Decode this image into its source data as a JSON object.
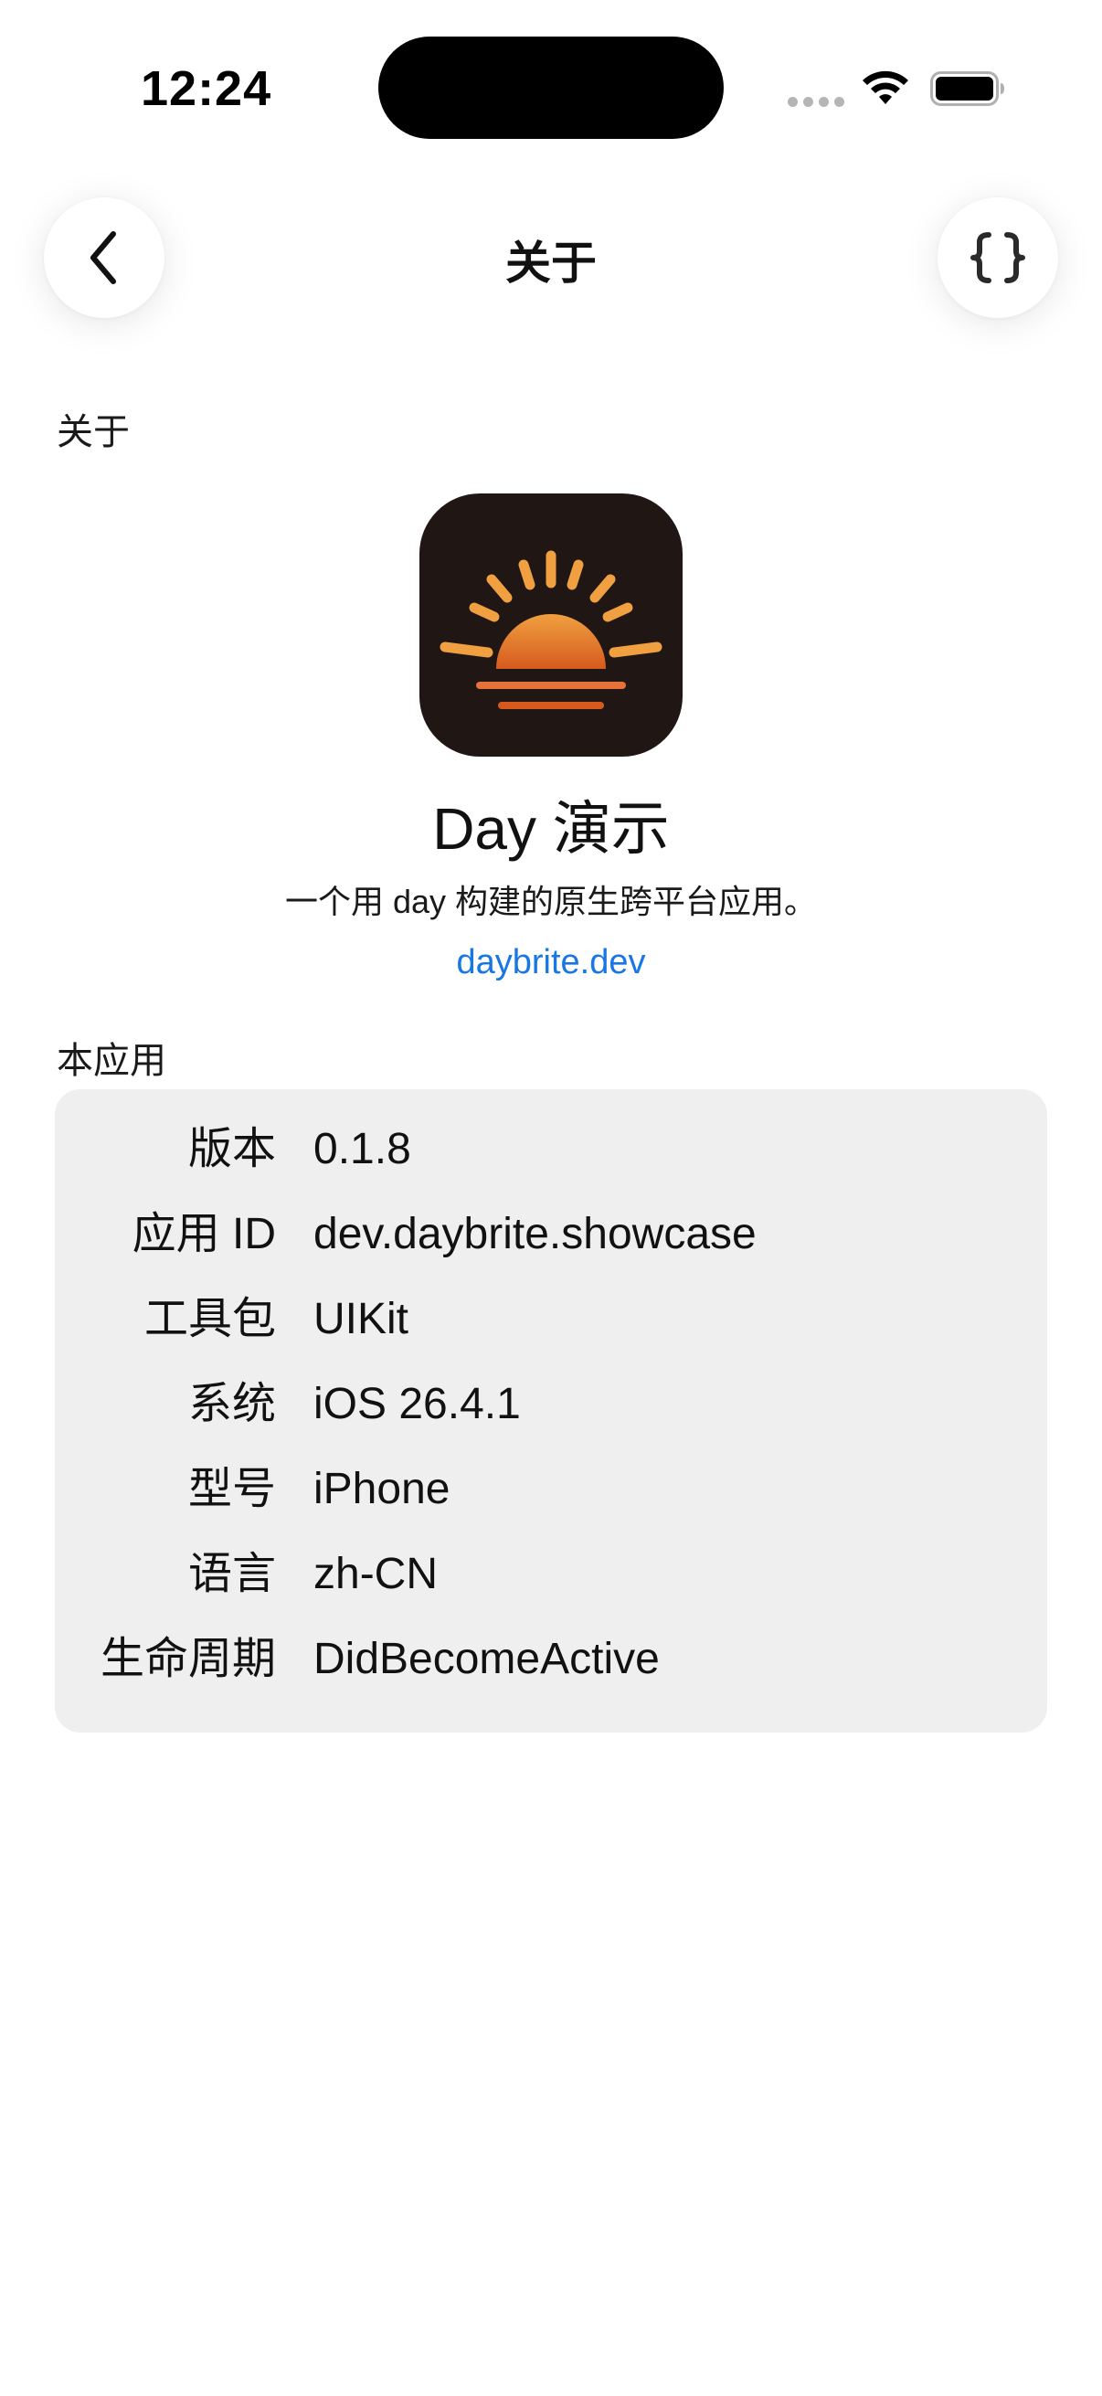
{
  "status_bar": {
    "time": "12:24",
    "icons": [
      "cellular-signal-icon",
      "wifi-icon",
      "battery-icon"
    ]
  },
  "nav": {
    "title": "关于",
    "back_icon": "chevron-left-icon",
    "code_icon": "curly-braces-icon"
  },
  "about": {
    "section_label": "关于",
    "app_icon": "sunrise-icon",
    "app_name": "Day 演示",
    "description": "一个用 day 构建的原生跨平台应用。",
    "link": "daybrite.dev"
  },
  "app_info": {
    "section_label": "本应用",
    "rows": [
      {
        "key": "版本",
        "value": "0.1.8"
      },
      {
        "key": "应用 ID",
        "value": "dev.daybrite.showcase"
      },
      {
        "key": "工具包",
        "value": "UIKit"
      },
      {
        "key": "系统",
        "value": "iOS 26.4.1"
      },
      {
        "key": "型号",
        "value": "iPhone"
      },
      {
        "key": "语言",
        "value": "zh-CN"
      },
      {
        "key": "生命周期",
        "value": "DidBecomeActive"
      }
    ]
  },
  "colors": {
    "link": "#1877e5",
    "card_background": "#efefef",
    "icon_background": "#201614",
    "icon_sun": "#f0a040",
    "icon_sun_dark": "#d65a1e"
  }
}
